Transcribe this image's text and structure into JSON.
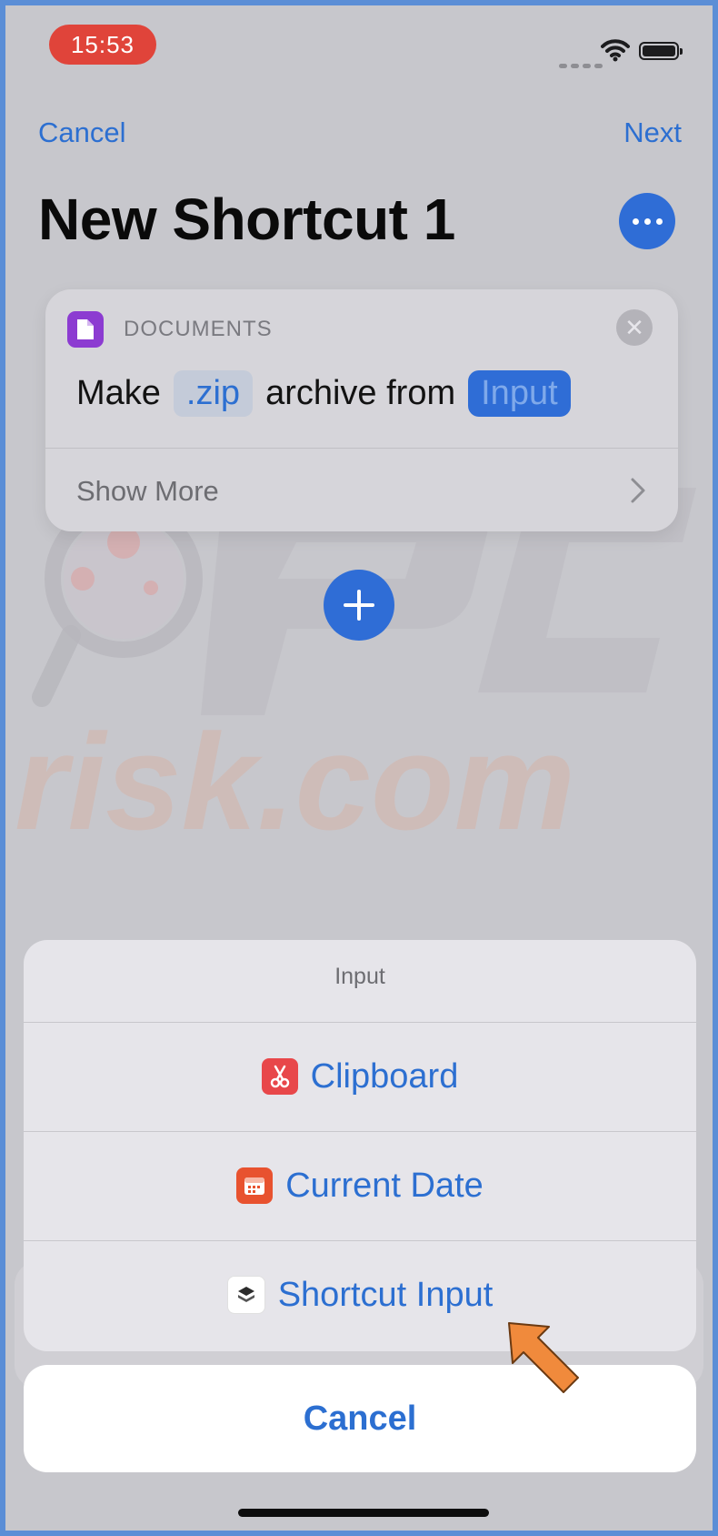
{
  "status_bar": {
    "time": "15:53"
  },
  "nav": {
    "cancel_label": "Cancel",
    "next_label": "Next"
  },
  "title": "New Shortcut 1",
  "action_card": {
    "category": "DOCUMENTS",
    "verb": "Make",
    "format_chip": ".zip",
    "middle_text": "archive from",
    "input_chip": "Input",
    "show_more": "Show More"
  },
  "sheet": {
    "title": "Input",
    "options": [
      {
        "label": "Clipboard",
        "icon": "scissors-icon"
      },
      {
        "label": "Current Date",
        "icon": "calendar-icon"
      },
      {
        "label": "Shortcut Input",
        "icon": "shortcuts-icon"
      }
    ],
    "cancel_label": "Cancel"
  },
  "colors": {
    "accent": "#2f6dd6",
    "link": "#2c6fd1",
    "time_pill": "#e0443a",
    "documents_icon": "#8c3bd1",
    "pointer_arrow": "#f08a3c"
  }
}
